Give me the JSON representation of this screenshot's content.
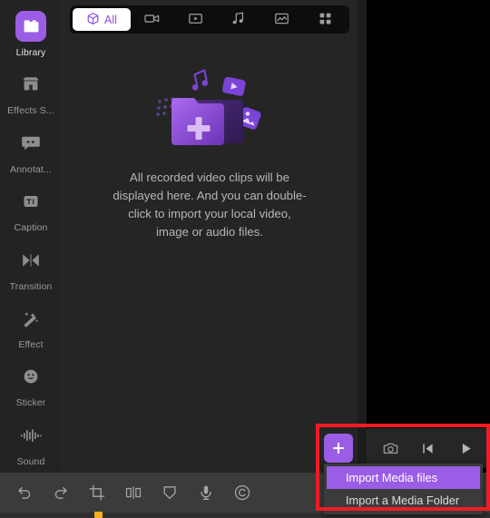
{
  "sidebar": {
    "items": [
      {
        "label": "Library",
        "icon": "folder-icon",
        "active": true
      },
      {
        "label": "Effects S...",
        "icon": "store-icon",
        "active": false
      },
      {
        "label": "Annotat...",
        "icon": "speech-bubble-icon",
        "active": false
      },
      {
        "label": "Caption",
        "icon": "text-icon",
        "active": false
      },
      {
        "label": "Transition",
        "icon": "transition-icon",
        "active": false
      },
      {
        "label": "Effect",
        "icon": "magic-wand-icon",
        "active": false
      },
      {
        "label": "Sticker",
        "icon": "smiley-icon",
        "active": false
      },
      {
        "label": "Sound",
        "icon": "waveform-icon",
        "active": false
      }
    ]
  },
  "filter_bar": {
    "tabs": [
      {
        "label": "All",
        "icon": "cube-icon",
        "active": true
      },
      {
        "label": "",
        "icon": "video-camera-icon",
        "active": false
      },
      {
        "label": "",
        "icon": "video-clip-icon",
        "active": false
      },
      {
        "label": "",
        "icon": "music-note-icon",
        "active": false
      },
      {
        "label": "",
        "icon": "image-icon",
        "active": false
      },
      {
        "label": "",
        "icon": "grid-icon",
        "active": false
      }
    ]
  },
  "empty_state": {
    "message": "All recorded video clips will be displayed here. And you can double-click to import your local video, image or audio files.",
    "illustration": "folder-plus-media-illustration"
  },
  "preview_controls": {
    "buttons": [
      {
        "name": "snapshot-button",
        "icon": "camera-icon"
      },
      {
        "name": "previous-frame-button",
        "icon": "skip-back-icon"
      },
      {
        "name": "play-button",
        "icon": "play-icon"
      }
    ]
  },
  "import": {
    "plus_button_label": "+",
    "menu": [
      {
        "label": "Import Media files",
        "highlighted": true
      },
      {
        "label": "Import a Media Folder",
        "highlighted": false
      }
    ]
  },
  "bottom_toolbar": {
    "tools": [
      {
        "name": "undo-button",
        "icon": "undo-icon"
      },
      {
        "name": "redo-button",
        "icon": "redo-icon"
      },
      {
        "name": "crop-button",
        "icon": "crop-icon"
      },
      {
        "name": "split-button",
        "icon": "split-icon"
      },
      {
        "name": "mask-button",
        "icon": "shield-icon"
      },
      {
        "name": "voiceover-button",
        "icon": "microphone-icon"
      },
      {
        "name": "watermark-button",
        "icon": "copyright-icon"
      }
    ]
  },
  "colors": {
    "accent_purple": "#9b5de5",
    "highlight_red": "#ef1c24",
    "clip_orange": "#f6b01e",
    "panel_bg": "#252525",
    "sidebar_bg": "#232323",
    "toolbar_bg": "#3b3b3b"
  }
}
